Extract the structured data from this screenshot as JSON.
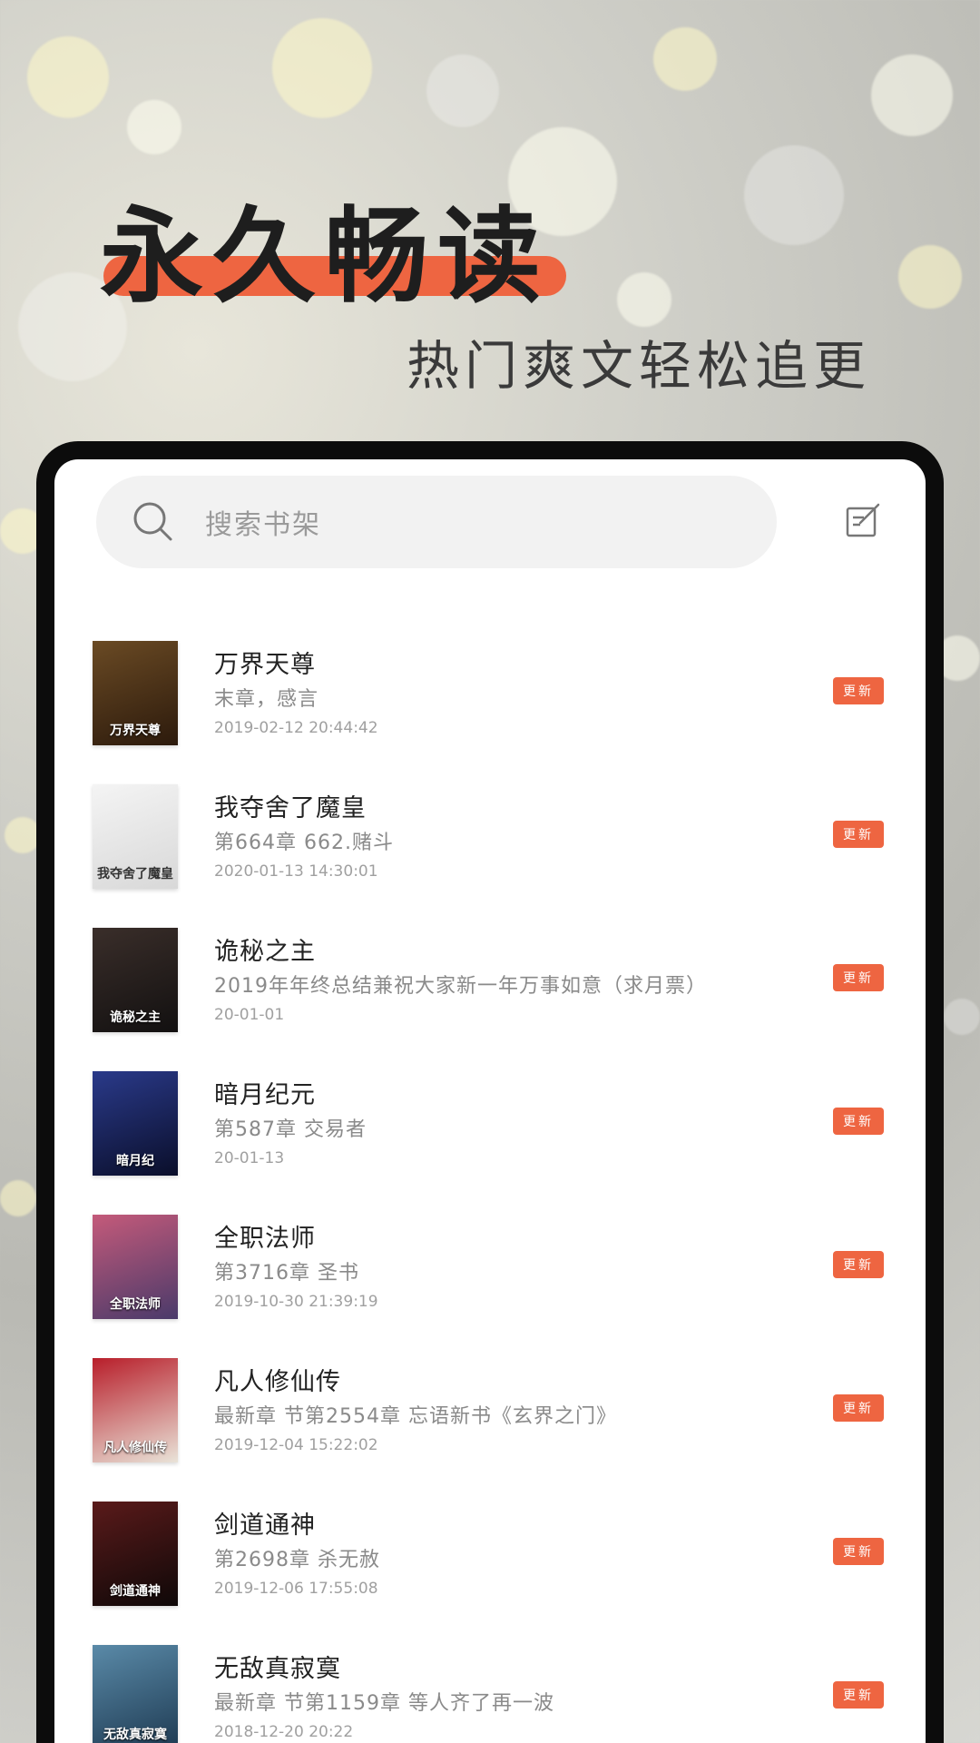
{
  "promo": {
    "headline": "永久畅读",
    "subheadline": "热门爽文轻松追更",
    "accent_color": "#ee6541"
  },
  "search": {
    "placeholder": "搜索书架",
    "icon": "search-icon",
    "edit_icon": "edit-icon"
  },
  "books": [
    {
      "title": "万界天尊",
      "chapter": "末章，感言",
      "time": "2019-02-12 20:44:42",
      "badge": "更新",
      "cover_text": "万界天尊",
      "cover_colors": [
        "#6a4a24",
        "#2c1a0c"
      ]
    },
    {
      "title": "我夺舍了魔皇",
      "chapter": "第664章 662.赌斗",
      "time": "2020-01-13 14:30:01",
      "badge": "更新",
      "cover_text": "我夺舍了魔皇",
      "cover_colors": [
        "#f4f4f4",
        "#d8d8d8"
      ]
    },
    {
      "title": "诡秘之主",
      "chapter": "2019年年终总结兼祝大家新一年万事如意（求月票）",
      "time": "20-01-01",
      "badge": "更新",
      "cover_text": "诡秘之主",
      "cover_colors": [
        "#3a2e2a",
        "#121010"
      ]
    },
    {
      "title": "暗月纪元",
      "chapter": "第587章 交易者",
      "time": "20-01-13",
      "badge": "更新",
      "cover_text": "暗月纪",
      "cover_colors": [
        "#2a3a8a",
        "#0a0e2a"
      ]
    },
    {
      "title": "全职法师",
      "chapter": "第3716章 圣书",
      "time": "2019-10-30 21:39:19",
      "badge": "更新",
      "cover_text": "全职法师",
      "cover_colors": [
        "#c45a7a",
        "#4a3a6a"
      ]
    },
    {
      "title": "凡人修仙传",
      "chapter": "最新章 节第2554章 忘语新书《玄界之门》",
      "time": "2019-12-04 15:22:02",
      "badge": "更新",
      "cover_text": "凡人修仙传",
      "cover_colors": [
        "#b81e2a",
        "#e9e3d8"
      ]
    },
    {
      "title": "剑道通神",
      "chapter": "第2698章 杀无赦",
      "time": "2019-12-06 17:55:08",
      "badge": "更新",
      "cover_text": "剑道通神",
      "cover_colors": [
        "#5a1a1a",
        "#0e0808"
      ]
    },
    {
      "title": "无敌真寂寞",
      "chapter": "最新章 节第1159章 等人齐了再一波",
      "time": "2018-12-20 20:22",
      "badge": "更新",
      "cover_text": "无敌真寂寞",
      "cover_colors": [
        "#5a8aa8",
        "#1e3a52"
      ]
    }
  ]
}
